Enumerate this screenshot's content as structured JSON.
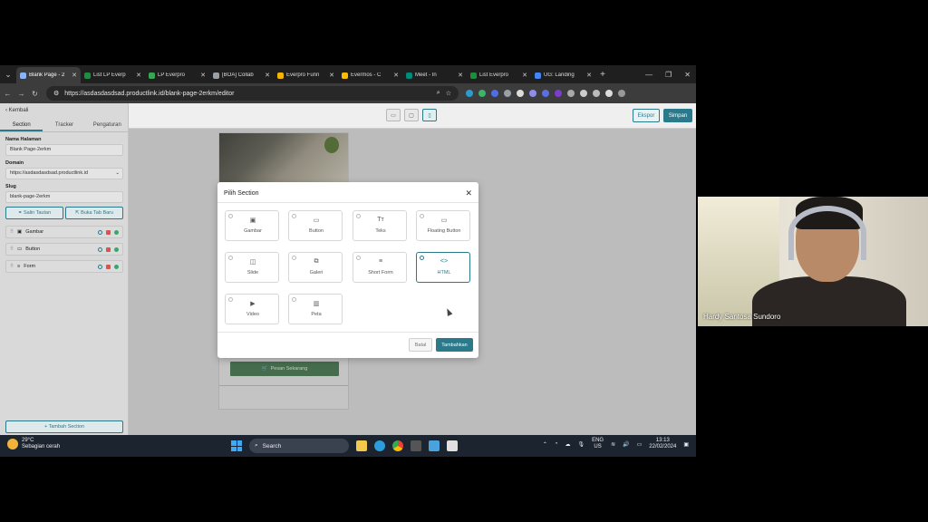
{
  "browser": {
    "tabs": [
      {
        "title": "Blank Page - 2",
        "color": "#8ab4f8",
        "active": true
      },
      {
        "title": "List LP Everp",
        "color": "#1e8e3e"
      },
      {
        "title": "LP Everpro",
        "color": "#34a853"
      },
      {
        "title": "[BOA] Collab",
        "color": "#9aa0a6"
      },
      {
        "title": "Everpro Funn",
        "color": "#f4b400"
      },
      {
        "title": "Evermos - C",
        "color": "#fbbc04"
      },
      {
        "title": "Meet - In",
        "color": "#00897b"
      },
      {
        "title": "List Everpro",
        "color": "#1e8e3e"
      },
      {
        "title": "UG: Landing",
        "color": "#4285f4"
      }
    ],
    "url": "https://asdasdasdsad.productlink.id/blank-page-2erkm/editor"
  },
  "editor": {
    "back": "Kembali",
    "tabs": [
      "Section",
      "Tracker",
      "Pengaturan"
    ],
    "fields": {
      "nama_label": "Nama Halaman",
      "nama_value": "Blank Page-2erkm",
      "domain_label": "Domain",
      "domain_value": "https://asdasdasdsad.productlink.id",
      "slug_label": "Slug",
      "slug_value": "blank-page-2erkm"
    },
    "salin_tautan": "Salin Tautan",
    "buka_tab": "Buka Tab Baru",
    "sections": [
      "Gambar",
      "Button",
      "Form"
    ],
    "tambah_section": "+ Tambah Section",
    "ekspor": "Ekspor",
    "simpan": "Simpan",
    "pesan": "Pesan Sekarang"
  },
  "modal": {
    "title": "Pilih Section",
    "options": [
      {
        "label": "Gambar",
        "icon": "image-icon"
      },
      {
        "label": "Button",
        "icon": "button-icon"
      },
      {
        "label": "Teks",
        "icon": "text-icon"
      },
      {
        "label": "Floating Button",
        "icon": "floating-button-icon"
      },
      {
        "label": "Slide",
        "icon": "slide-icon"
      },
      {
        "label": "Galeri",
        "icon": "gallery-icon"
      },
      {
        "label": "Short Form",
        "icon": "form-icon"
      },
      {
        "label": "HTML",
        "icon": "code-icon",
        "selected": true
      },
      {
        "label": "Video",
        "icon": "video-icon"
      },
      {
        "label": "Peta",
        "icon": "map-icon"
      }
    ],
    "batal": "Batal",
    "tambahkan": "Tambahkan"
  },
  "taskbar": {
    "temp": "29°C",
    "weather": "Sebagian cerah",
    "search": "Search",
    "lang1": "ENG",
    "lang2": "US",
    "time": "13:13",
    "date": "22/02/2024"
  },
  "webcam": {
    "name": "Hardy Santosa Sundoro"
  }
}
